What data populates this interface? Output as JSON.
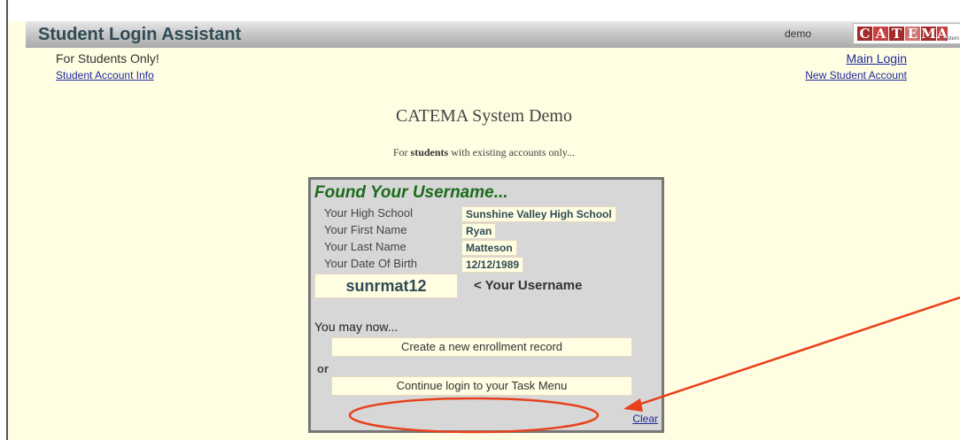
{
  "header": {
    "title": "Student Login Assistant",
    "user": "demo",
    "logo": {
      "letters": [
        "C",
        "A",
        "T",
        "E",
        "M",
        "A"
      ],
      "subtitle": "System",
      "colors": [
        "#a52a2a",
        "#c94040",
        "#a52a2a",
        "#d07070",
        "#a52a2a",
        "#c94040"
      ]
    }
  },
  "nav": {
    "for_students": "For Students Only!",
    "student_account_info": "Student Account Info",
    "main_login": "Main Login",
    "new_student_account": "New Student Account"
  },
  "main": {
    "title": "CATEMA System Demo",
    "subtitle_prefix": "For ",
    "subtitle_bold": "students",
    "subtitle_suffix": " with existing accounts only..."
  },
  "panel": {
    "heading": "Found Your Username...",
    "rows": [
      {
        "label": "Your High School",
        "value": "Sunshine Valley High School"
      },
      {
        "label": "Your First Name",
        "value": "Ryan"
      },
      {
        "label": "Your Last Name",
        "value": "Matteson"
      },
      {
        "label": "Your Date Of Birth",
        "value": "12/12/1989"
      }
    ],
    "username": "sunrmat12",
    "username_hint": "< Your Username",
    "may_now": "You may now...",
    "create_button": "Create a new enrollment record",
    "or": "or",
    "continue_button": "Continue login to your Task Menu",
    "clear": "Clear"
  },
  "annotation_color": "#e8401c"
}
